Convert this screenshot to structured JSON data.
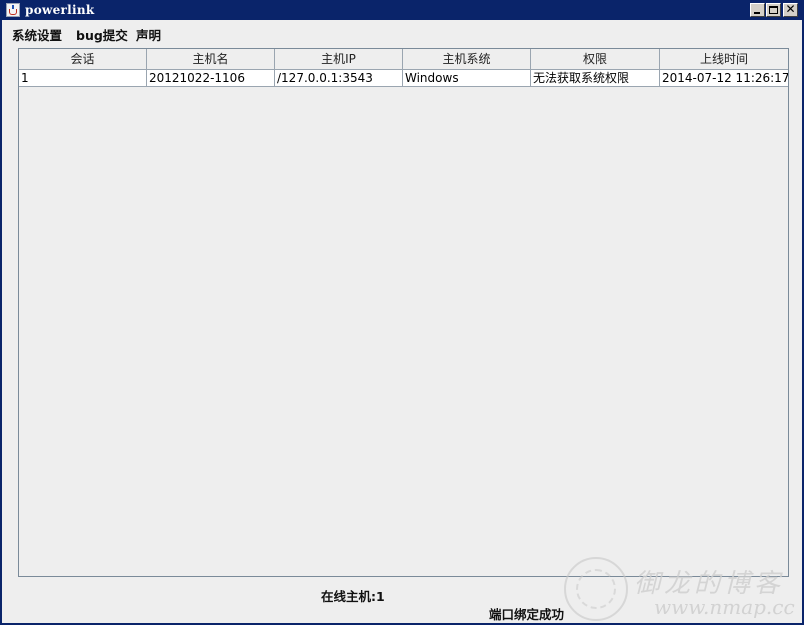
{
  "window": {
    "title": "powerlink",
    "icon": "java-cup-icon",
    "controls": {
      "minimize": "minimize-icon",
      "maximize": "maximize-icon",
      "close": "✕"
    }
  },
  "menu": {
    "items": [
      {
        "label": "系统设置"
      },
      {
        "label": "bug提交"
      },
      {
        "label": "声明"
      }
    ]
  },
  "table": {
    "columns": [
      "会话",
      "主机名",
      "主机IP",
      "主机系统",
      "权限",
      "上线时间"
    ],
    "rows": [
      {
        "cells": [
          "1",
          "20121022-1106",
          "/127.0.0.1:3543",
          "Windows",
          "无法获取系统权限",
          "2014-07-12 11:26:17"
        ]
      }
    ]
  },
  "status": {
    "online_hosts": "在线主机:1",
    "port_bind": "端口绑定成功"
  },
  "watermark": {
    "text_cn": "御龙的博客",
    "url": "www.nmap.cc"
  }
}
